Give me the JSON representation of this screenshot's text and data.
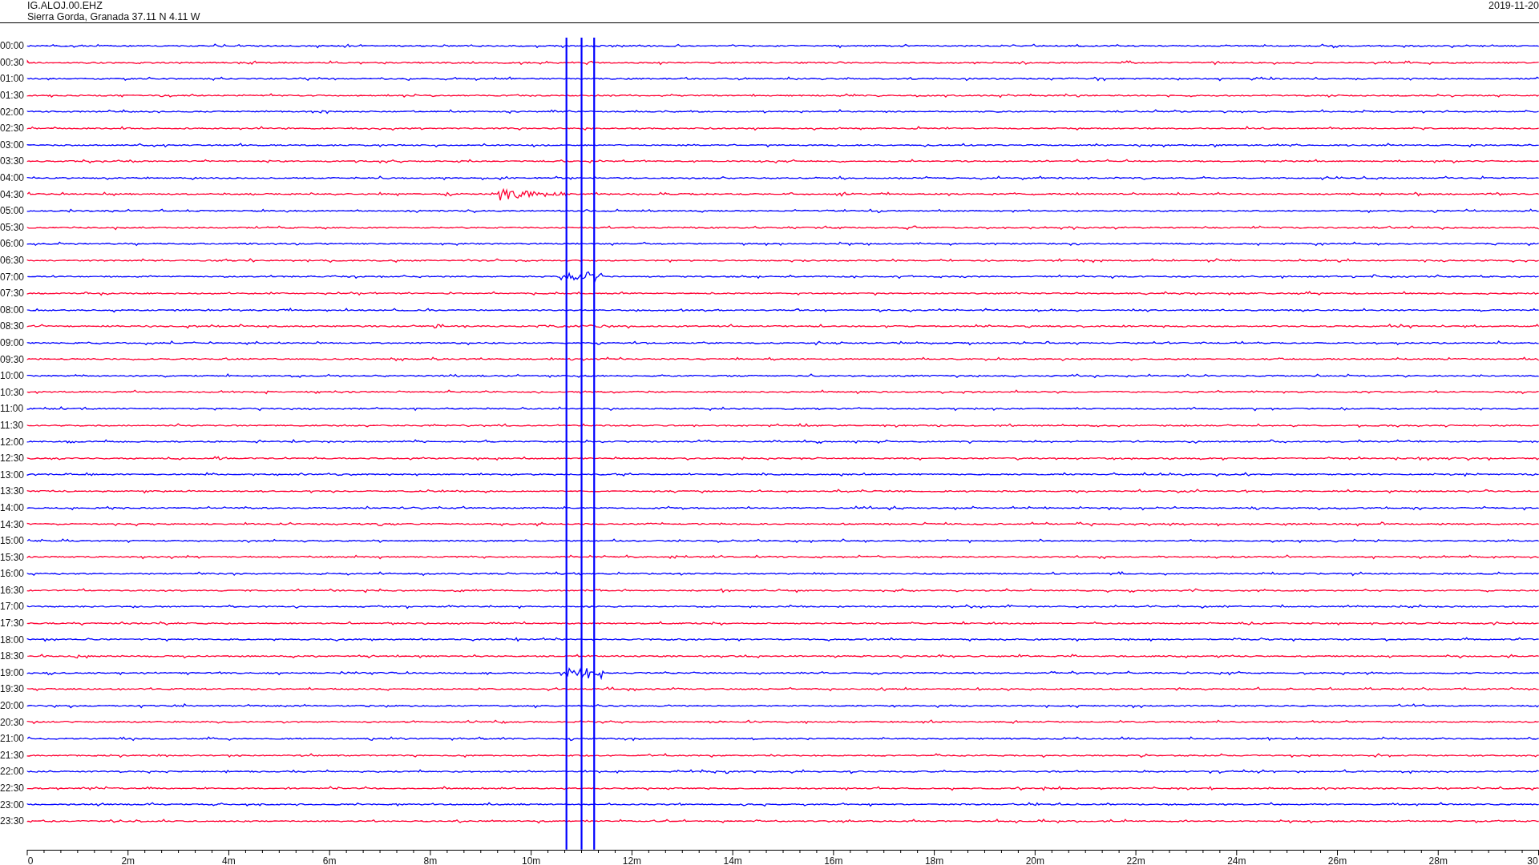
{
  "header": {
    "station": "IG.ALOJ.00.EHZ",
    "location": "Sierra Gorda, Granada  37.11 N 4.11 W",
    "date": "2019-11-20"
  },
  "rows": [
    {
      "time": "00:00",
      "color": "#0000ff"
    },
    {
      "time": "00:30",
      "color": "#ff0033"
    },
    {
      "time": "01:00",
      "color": "#0000ff"
    },
    {
      "time": "01:30",
      "color": "#ff0033"
    },
    {
      "time": "02:00",
      "color": "#0000ff"
    },
    {
      "time": "02:30",
      "color": "#ff0033"
    },
    {
      "time": "03:00",
      "color": "#0000ff"
    },
    {
      "time": "03:30",
      "color": "#ff0033"
    },
    {
      "time": "04:00",
      "color": "#0000ff"
    },
    {
      "time": "04:30",
      "color": "#ff0033"
    },
    {
      "time": "05:00",
      "color": "#0000ff"
    },
    {
      "time": "05:30",
      "color": "#ff0033"
    },
    {
      "time": "06:00",
      "color": "#0000ff"
    },
    {
      "time": "06:30",
      "color": "#ff0033"
    },
    {
      "time": "07:00",
      "color": "#0000ff"
    },
    {
      "time": "07:30",
      "color": "#ff0033"
    },
    {
      "time": "08:00",
      "color": "#0000ff"
    },
    {
      "time": "08:30",
      "color": "#ff0033"
    },
    {
      "time": "09:00",
      "color": "#0000ff"
    },
    {
      "time": "09:30",
      "color": "#ff0033"
    },
    {
      "time": "10:00",
      "color": "#0000ff"
    },
    {
      "time": "10:30",
      "color": "#ff0033"
    },
    {
      "time": "11:00",
      "color": "#0000ff"
    },
    {
      "time": "11:30",
      "color": "#ff0033"
    },
    {
      "time": "12:00",
      "color": "#0000ff"
    },
    {
      "time": "12:30",
      "color": "#ff0033"
    },
    {
      "time": "13:00",
      "color": "#0000ff"
    },
    {
      "time": "13:30",
      "color": "#ff0033"
    },
    {
      "time": "14:00",
      "color": "#0000ff"
    },
    {
      "time": "14:30",
      "color": "#ff0033"
    },
    {
      "time": "15:00",
      "color": "#0000ff"
    },
    {
      "time": "15:30",
      "color": "#ff0033"
    },
    {
      "time": "16:00",
      "color": "#0000ff"
    },
    {
      "time": "16:30",
      "color": "#ff0033"
    },
    {
      "time": "17:00",
      "color": "#0000ff"
    },
    {
      "time": "17:30",
      "color": "#ff0033"
    },
    {
      "time": "18:00",
      "color": "#0000ff"
    },
    {
      "time": "18:30",
      "color": "#ff0033"
    },
    {
      "time": "19:00",
      "color": "#0000ff"
    },
    {
      "time": "19:30",
      "color": "#ff0033"
    },
    {
      "time": "20:00",
      "color": "#0000ff"
    },
    {
      "time": "20:30",
      "color": "#ff0033"
    },
    {
      "time": "21:00",
      "color": "#0000ff"
    },
    {
      "time": "21:30",
      "color": "#ff0033"
    },
    {
      "time": "22:00",
      "color": "#0000ff"
    },
    {
      "time": "22:30",
      "color": "#ff0033"
    },
    {
      "time": "23:00",
      "color": "#0000ff"
    },
    {
      "time": "23:30",
      "color": "#ff0033"
    }
  ],
  "axis": {
    "labels": [
      "0",
      "2m",
      "4m",
      "6m",
      "8m",
      "10m",
      "12m",
      "14m",
      "16m",
      "18m",
      "20m",
      "22m",
      "24m",
      "26m",
      "28m",
      "30"
    ]
  }
}
